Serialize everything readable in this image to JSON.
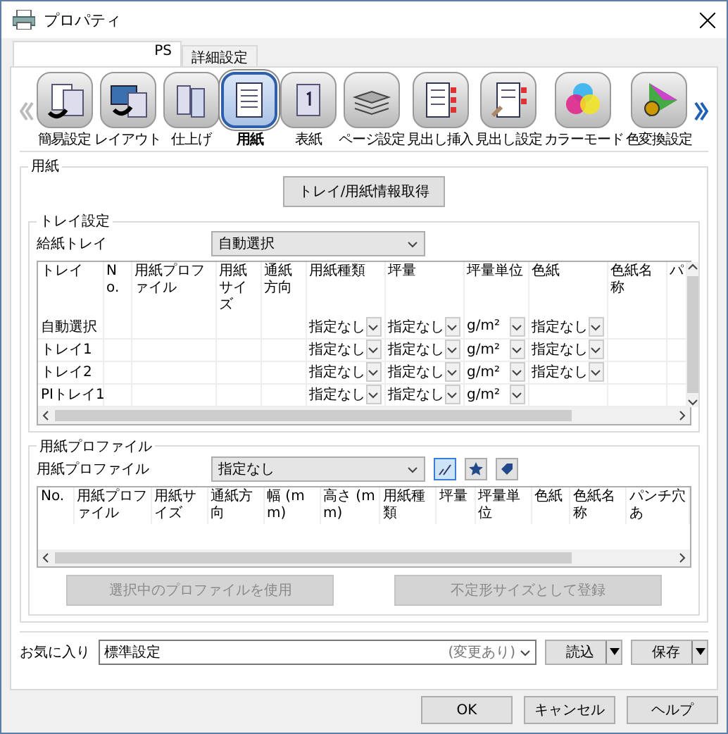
{
  "window": {
    "title": "プロパティ"
  },
  "tabs": [
    {
      "label": "PS",
      "selected": true
    },
    {
      "label": "詳細設定",
      "selected": false
    }
  ],
  "toolbar": [
    {
      "label": "簡易設定",
      "selected": false
    },
    {
      "label": "レイアウト",
      "selected": false
    },
    {
      "label": "仕上げ",
      "selected": false
    },
    {
      "label": "用紙",
      "selected": true
    },
    {
      "label": "表紙",
      "selected": false
    },
    {
      "label": "ページ設定",
      "selected": false
    },
    {
      "label": "見出し挿入",
      "selected": false
    },
    {
      "label": "見出し設定",
      "selected": false
    },
    {
      "label": "カラーモード",
      "selected": false
    },
    {
      "label": "色変換設定",
      "selected": false
    }
  ],
  "paper_group": {
    "title": "用紙",
    "fetch_button": "トレイ/用紙情報取得",
    "tray_settings": {
      "title": "トレイ設定",
      "feed_tray_label": "給紙トレイ",
      "feed_tray_value": "自動選択",
      "columns": [
        "トレイ",
        "No.",
        "用紙プロファイル",
        "用紙サイズ",
        "通紙方向",
        "用紙種類",
        "坪量",
        "坪量単位",
        "色紙",
        "色紙名称",
        "パ"
      ],
      "rows": [
        {
          "tray": "自動選択",
          "paper_type": "指定なし",
          "weight": "指定なし",
          "weight_unit": "g/m²",
          "color_paper": "指定なし"
        },
        {
          "tray": "トレイ1",
          "paper_type": "指定なし",
          "weight": "指定なし",
          "weight_unit": "g/m²",
          "color_paper": "指定なし"
        },
        {
          "tray": "トレイ2",
          "paper_type": "指定なし",
          "weight": "指定なし",
          "weight_unit": "g/m²",
          "color_paper": "指定なし"
        },
        {
          "tray": "PIトレイ1",
          "paper_type": "指定なし",
          "weight": "指定なし",
          "weight_unit": "g/m²"
        }
      ]
    },
    "profile": {
      "title": "用紙プロファイル",
      "label": "用紙プロファイル",
      "value": "指定なし",
      "tool_buttons": [
        {
          "selected": true
        },
        {
          "selected": false
        },
        {
          "selected": false
        }
      ],
      "columns": [
        "No.",
        "用紙プロファイル",
        "用紙サイズ",
        "通紙方向",
        "幅 (mm)",
        "高さ (mm)",
        "用紙種類",
        "坪量",
        "坪量単位",
        "色紙",
        "色紙名称",
        "パンチ穴あ"
      ],
      "use_button": {
        "label": "選択中のプロファイルを使用",
        "disabled": true
      },
      "register_button": {
        "label": "不定形サイズとして登録",
        "disabled": true
      }
    }
  },
  "favorites": {
    "label": "お気に入り",
    "value": "標準設定",
    "note": "(変更あり)",
    "load_button": "読込",
    "save_button": "保存"
  },
  "buttons": [
    "OK",
    "キャンセル",
    "ヘルプ"
  ]
}
